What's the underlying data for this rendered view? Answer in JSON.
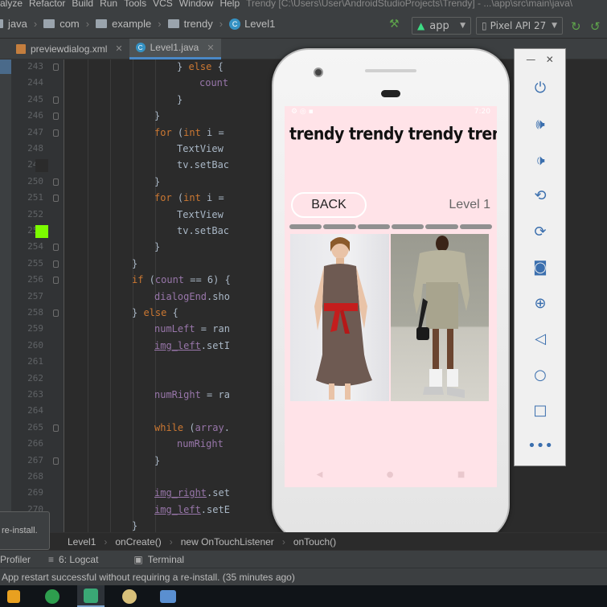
{
  "menu": {
    "items": [
      "alyze",
      "Refactor",
      "Build",
      "Run",
      "Tools",
      "VCS",
      "Window",
      "Help"
    ],
    "window_title": "Trendy [C:\\Users\\User\\AndroidStudioProjects\\Trendy] - ...\\app\\src\\main\\java\\"
  },
  "breadcrumb": {
    "items": [
      "java",
      "com",
      "example",
      "trendy",
      "Level1"
    ]
  },
  "toolbar": {
    "run_config": "app",
    "device": "Pixel API 27"
  },
  "tabs": [
    {
      "label": "previewdialog.xml",
      "active": false
    },
    {
      "label": "Level1.java",
      "active": true
    }
  ],
  "editor": {
    "line_numbers": [
      "243",
      "244",
      "245",
      "246",
      "247",
      "248",
      "249",
      "250",
      "251",
      "252",
      "253",
      "254",
      "255",
      "256",
      "257",
      "258",
      "259",
      "260",
      "261",
      "262",
      "263",
      "264",
      "265",
      "266",
      "267",
      "268",
      "269",
      "270"
    ],
    "lines": [
      {
        "indent": 7,
        "parts": [
          {
            "t": "} ",
            "c": ""
          },
          {
            "t": "else",
            "c": "kw"
          },
          {
            "t": " {",
            "c": ""
          }
        ]
      },
      {
        "indent": 8,
        "parts": [
          {
            "t": "count",
            "c": "purple"
          }
        ]
      },
      {
        "indent": 7,
        "parts": [
          {
            "t": "}",
            "c": ""
          }
        ]
      },
      {
        "indent": 6,
        "parts": [
          {
            "t": "}",
            "c": ""
          }
        ]
      },
      {
        "indent": 6,
        "parts": [
          {
            "t": "for",
            "c": "kw"
          },
          {
            "t": " (",
            "c": ""
          },
          {
            "t": "int",
            "c": "kw"
          },
          {
            "t": " i = ",
            "c": ""
          }
        ]
      },
      {
        "indent": 7,
        "parts": [
          {
            "t": "TextView",
            "c": ""
          }
        ]
      },
      {
        "indent": 7,
        "parts": [
          {
            "t": "tv.setBac",
            "c": ""
          }
        ]
      },
      {
        "indent": 6,
        "parts": [
          {
            "t": "}",
            "c": ""
          }
        ]
      },
      {
        "indent": 6,
        "parts": [
          {
            "t": "for",
            "c": "kw"
          },
          {
            "t": " (",
            "c": ""
          },
          {
            "t": "int",
            "c": "kw"
          },
          {
            "t": " i = ",
            "c": ""
          }
        ]
      },
      {
        "indent": 7,
        "parts": [
          {
            "t": "TextView",
            "c": ""
          }
        ]
      },
      {
        "indent": 7,
        "parts": [
          {
            "t": "tv.setBac",
            "c": ""
          }
        ]
      },
      {
        "indent": 6,
        "parts": [
          {
            "t": "}",
            "c": ""
          }
        ]
      },
      {
        "indent": 5,
        "parts": [
          {
            "t": "}",
            "c": ""
          }
        ]
      },
      {
        "indent": 5,
        "parts": [
          {
            "t": "if",
            "c": "kw"
          },
          {
            "t": " (",
            "c": ""
          },
          {
            "t": "count",
            "c": "purple"
          },
          {
            "t": " == 6) {",
            "c": ""
          }
        ]
      },
      {
        "indent": 6,
        "parts": [
          {
            "t": "dialogEnd",
            "c": "purple"
          },
          {
            "t": ".sho",
            "c": ""
          }
        ]
      },
      {
        "indent": 5,
        "parts": [
          {
            "t": "} ",
            "c": ""
          },
          {
            "t": "else",
            "c": "kw"
          },
          {
            "t": " {",
            "c": ""
          }
        ]
      },
      {
        "indent": 6,
        "parts": [
          {
            "t": "numLeft",
            "c": "purple"
          },
          {
            "t": " = ran",
            "c": ""
          }
        ]
      },
      {
        "indent": 6,
        "parts": [
          {
            "t": "img_left",
            "c": "ul"
          },
          {
            "t": ".setI",
            "c": ""
          }
        ]
      },
      {
        "indent": 6,
        "parts": []
      },
      {
        "indent": 6,
        "parts": []
      },
      {
        "indent": 6,
        "parts": [
          {
            "t": "numRight",
            "c": "purple"
          },
          {
            "t": " = ra",
            "c": ""
          }
        ]
      },
      {
        "indent": 6,
        "parts": []
      },
      {
        "indent": 6,
        "parts": [
          {
            "t": "while",
            "c": "kw"
          },
          {
            "t": " (",
            "c": ""
          },
          {
            "t": "array",
            "c": "purple"
          },
          {
            "t": ".",
            "c": ""
          }
        ]
      },
      {
        "indent": 7,
        "parts": [
          {
            "t": "numRight",
            "c": "purple"
          }
        ]
      },
      {
        "indent": 6,
        "parts": [
          {
            "t": "}",
            "c": ""
          }
        ]
      },
      {
        "indent": 6,
        "parts": []
      },
      {
        "indent": 6,
        "parts": [
          {
            "t": "img_right",
            "c": "ul"
          },
          {
            "t": ".set",
            "c": ""
          }
        ]
      },
      {
        "indent": 6,
        "parts": [
          {
            "t": "img_left",
            "c": "ul"
          },
          {
            "t": ".setE",
            "c": ""
          }
        ]
      }
    ],
    "trailing_line": "}"
  },
  "toast": {
    "text": "re-install."
  },
  "method_breadcrumb": [
    "Level1",
    "onCreate()",
    "new OnTouchListener",
    "onTouch()"
  ],
  "tool_windows": [
    "Profiler",
    "6: Logcat",
    "Terminal"
  ],
  "status": {
    "message": "App restart successful without requiring a re-install. (35 minutes ago)"
  },
  "emulator": {
    "app_title": "trendy trendy trendy trendy",
    "back_label": "BACK",
    "level_label": "Level 1",
    "status_time": "7:20",
    "progress_segments": 6,
    "photos": [
      "left-outfit-photo",
      "right-outfit-photo"
    ]
  },
  "emulator_controls": [
    "power-icon",
    "volume-up-icon",
    "volume-down-icon",
    "rotate-left-icon",
    "rotate-right-icon",
    "camera-icon",
    "zoom-icon",
    "back-icon",
    "home-icon",
    "overview-icon",
    "more-icon"
  ],
  "colors": {
    "ide_bg": "#2b2b2b",
    "app_bg": "#ffe3e8",
    "keyword": "#cc7832",
    "field": "#9876aa",
    "swatch_dark": "#2b2b2b",
    "swatch_green": "#7cfc00"
  }
}
